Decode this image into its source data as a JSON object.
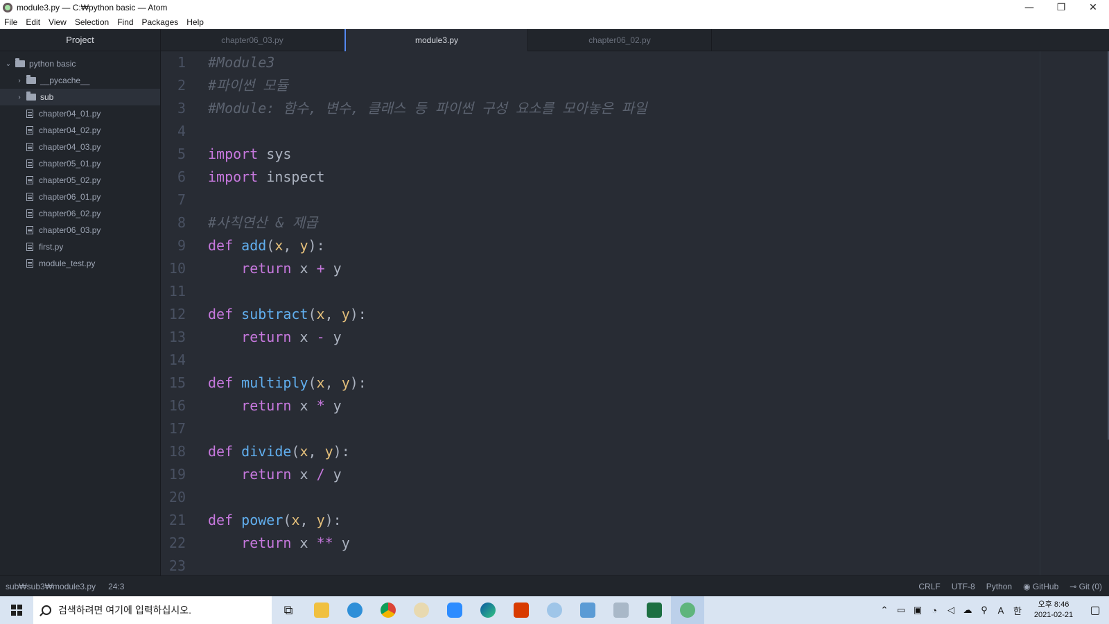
{
  "window": {
    "title": "module3.py — C:₩python basic — Atom",
    "controls": {
      "minimize": "—",
      "restore": "❐",
      "close": "✕"
    }
  },
  "menu": [
    "File",
    "Edit",
    "View",
    "Selection",
    "Find",
    "Packages",
    "Help"
  ],
  "sidebar": {
    "title": "Project",
    "root": "python basic",
    "folders": [
      "__pycache__",
      "sub"
    ],
    "files": [
      "chapter04_01.py",
      "chapter04_02.py",
      "chapter04_03.py",
      "chapter05_01.py",
      "chapter05_02.py",
      "chapter06_01.py",
      "chapter06_02.py",
      "chapter06_03.py",
      "first.py",
      "module_test.py"
    ]
  },
  "tabs": [
    {
      "label": "chapter06_03.py"
    },
    {
      "label": "module3.py"
    },
    {
      "label": "chapter06_02.py"
    }
  ],
  "editor": {
    "line_numbers": [
      "1",
      "2",
      "3",
      "4",
      "5",
      "6",
      "7",
      "8",
      "9",
      "10",
      "11",
      "12",
      "13",
      "14",
      "15",
      "16",
      "17",
      "18",
      "19",
      "20",
      "21",
      "22",
      "23"
    ],
    "code": {
      "l1": "#Module3",
      "l2": "#파이썬 모듈",
      "l3": "#Module: 함수, 변수, 클래스 등 파이썬 구성 요소를 모아놓은 파일",
      "kw_import": "import",
      "mod_sys": "sys",
      "mod_inspect": "inspect",
      "l8": "#사칙연산 & 제곱",
      "kw_def": "def",
      "kw_return": "return",
      "fn_add": "add",
      "fn_subtract": "subtract",
      "fn_multiply": "multiply",
      "fn_divide": "divide",
      "fn_power": "power",
      "p_x": "x",
      "p_y": "y",
      "op_add": "+",
      "op_sub": "-",
      "op_mul": "*",
      "op_div": "/",
      "op_pow": "**"
    }
  },
  "statusbar": {
    "path": "sub₩sub3₩module3.py",
    "cursor": "24:3",
    "line_ending": "CRLF",
    "encoding": "UTF-8",
    "grammar": "Python",
    "github": "GitHub",
    "git": "Git (0)"
  },
  "taskbar": {
    "search_placeholder": "검색하려면 여기에 입력하십시오.",
    "clock_time": "오후 8:46",
    "clock_date": "2021-02-21",
    "ime_a": "A",
    "ime_han": "한"
  },
  "colors": {
    "accent": "#568af2",
    "editor_bg": "#282c34",
    "panel_bg": "#21252b"
  }
}
